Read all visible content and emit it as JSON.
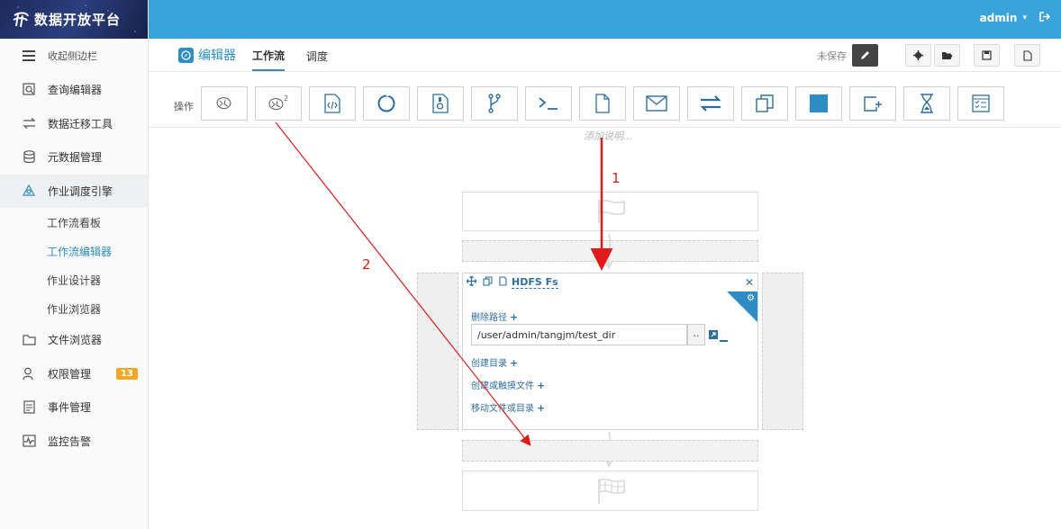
{
  "brand": {
    "title": "数据开放平台"
  },
  "topbar": {
    "user": "admin"
  },
  "sidebar": {
    "collapse_label": "收起侧边栏",
    "items": [
      {
        "label": "查询编辑器",
        "icon": "query-icon"
      },
      {
        "label": "数据迁移工具",
        "icon": "transfer-icon"
      },
      {
        "label": "元数据管理",
        "icon": "database-icon"
      },
      {
        "label": "作业调度引擎",
        "icon": "scheduler-icon"
      }
    ],
    "subitems": [
      {
        "label": "工作流看板"
      },
      {
        "label": "工作流编辑器"
      },
      {
        "label": "作业设计器"
      },
      {
        "label": "作业浏览器"
      }
    ],
    "items2": [
      {
        "label": "文件浏览器",
        "icon": "folder-icon"
      },
      {
        "label": "权限管理",
        "icon": "user-icon",
        "badge": "13"
      },
      {
        "label": "事件管理",
        "icon": "event-icon"
      },
      {
        "label": "监控告警",
        "icon": "monitor-icon"
      }
    ]
  },
  "editor": {
    "title": "编辑器",
    "tabs": [
      "工作流",
      "调度"
    ],
    "unsaved": "未保存"
  },
  "toolbar": {
    "label": "操作",
    "hint": "添加说明..."
  },
  "node": {
    "name": "HDFS Fs",
    "delete_path_label": "删除路径",
    "path_value": "/user/admin/tangjm/test_dir",
    "browse_label": "..",
    "mkdir_label": "创建目录",
    "touch_label": "创建或触摸文件",
    "move_label": "移动文件或目录"
  },
  "annotations": {
    "arrow1": "1",
    "arrow2": "2"
  },
  "colors": {
    "accent": "#2f8dc5",
    "topbar": "#3aa3d9",
    "annotation": "#e01b1b",
    "badge": "#f0a823"
  }
}
